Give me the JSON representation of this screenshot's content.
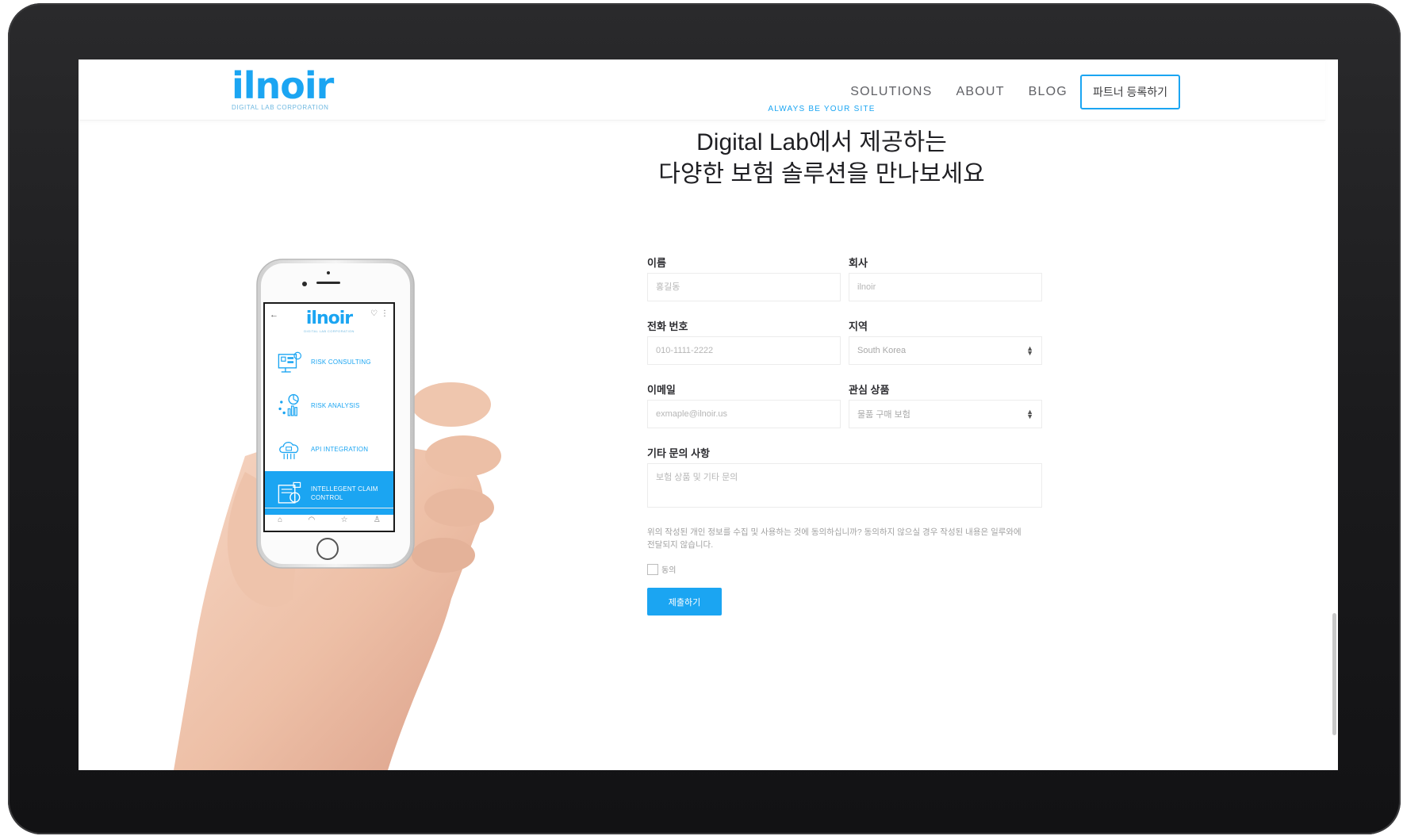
{
  "brand": {
    "logo_text": "ilnoir",
    "logo_tagline": "DIGITAL LAB CORPORATION",
    "accent_color": "#1ba5f2"
  },
  "nav": {
    "links": [
      "SOLUTIONS",
      "ABOUT",
      "BLOG"
    ],
    "partner_button": "파트너 등록하기"
  },
  "hero": {
    "eyebrow": "ALWAYS BE YOUR SITE",
    "heading_line1": "Digital Lab에서 제공하는",
    "heading_line2": "다양한 보험 솔루션을 만나보세요"
  },
  "phone": {
    "logo_text": "ilnoir",
    "logo_tagline": "DIGITAL LAB CORPORATION",
    "menu": [
      {
        "label": "RISK CONSULTING",
        "icon": "consulting-icon"
      },
      {
        "label": "RISK ANALYSIS",
        "icon": "analysis-icon"
      },
      {
        "label": "API INTEGRATION",
        "icon": "cloud-api-icon"
      },
      {
        "label": "INTELLEGENT CLAIM CONTROL",
        "icon": "claim-icon",
        "active": true
      }
    ],
    "tabbar_icons": [
      "home-icon",
      "dashboard-icon",
      "star-icon",
      "profile-icon"
    ]
  },
  "form": {
    "name": {
      "label": "이름",
      "placeholder": "홍길동"
    },
    "company": {
      "label": "회사",
      "placeholder": "ilnoir"
    },
    "phone": {
      "label": "전화 번호",
      "placeholder": "010-1111-2222"
    },
    "region": {
      "label": "지역",
      "value": "South Korea"
    },
    "email": {
      "label": "이메일",
      "placeholder": "exmaple@ilnoir.us"
    },
    "interest": {
      "label": "관심 상품",
      "value": "물품 구매 보험"
    },
    "inquiry": {
      "label": "기타 문의 사항",
      "placeholder": "보험 상품 및 기타 문의"
    },
    "consent_text": "위의 작성된 개인 정보를 수집 및 사용하는 것에 동의하십니까? 동의하지 않으실 경우 작성된 내용은 일루와에 전달되지 않습니다.",
    "agree_label": "동의",
    "submit_label": "제출하기"
  }
}
